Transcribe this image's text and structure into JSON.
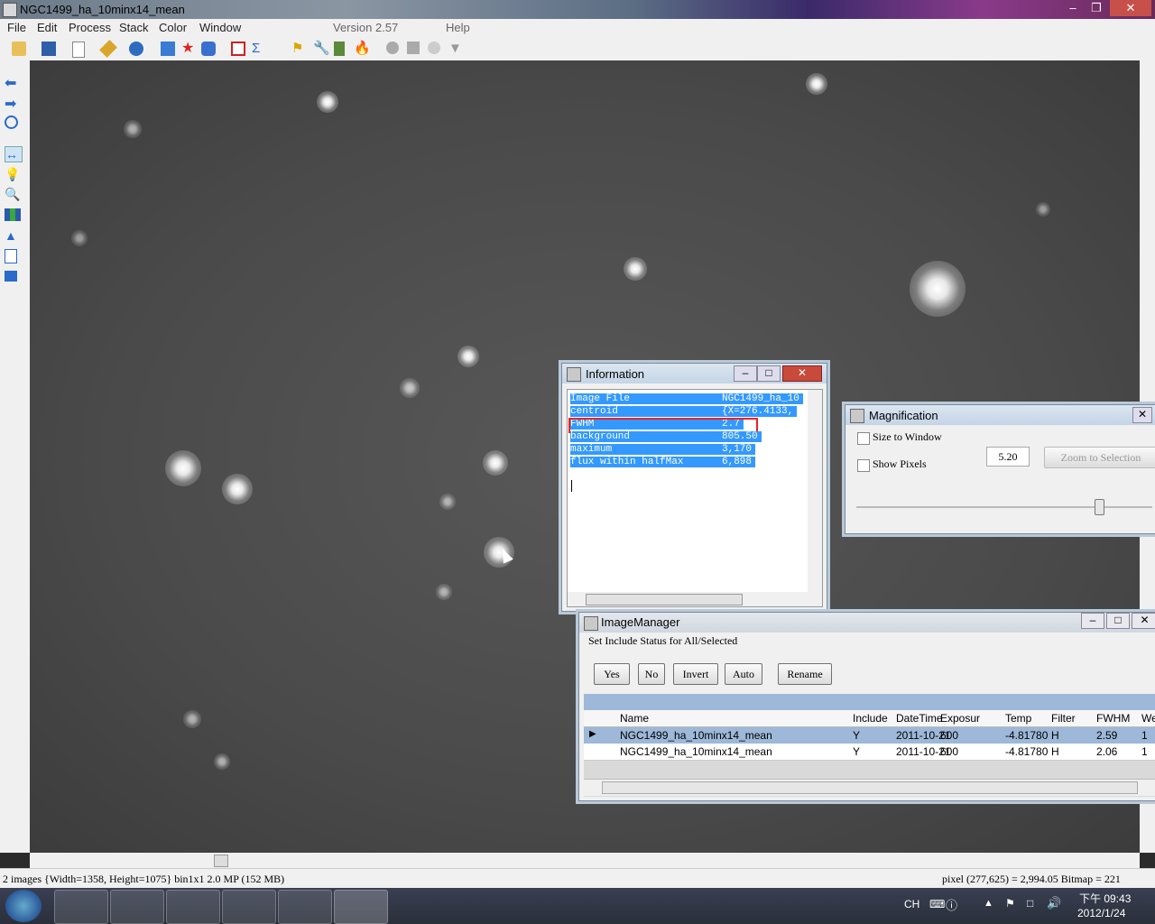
{
  "window": {
    "title": "NGC1499_ha_10minx14_mean"
  },
  "menu": {
    "file": "File",
    "edit": "Edit",
    "process": "Process",
    "stack": "Stack",
    "color": "Color",
    "window": "Window",
    "version": "Version 2.57",
    "help": "Help"
  },
  "info": {
    "title": "Information",
    "rows": [
      {
        "label": "Image File",
        "value": "NGC1499_ha_10"
      },
      {
        "label": "centroid",
        "value": "{X=276.4133,"
      },
      {
        "label": "FWHM",
        "value": "2.7"
      },
      {
        "label": "background",
        "value": "805.50"
      },
      {
        "label": "maximum",
        "value": "3,170"
      },
      {
        "label": "flux within halfMax",
        "value": "6,898"
      }
    ]
  },
  "magnification": {
    "title": "Magnification",
    "size_to_window": "Size to Window",
    "show_pixels": "Show Pixels",
    "value": "5.20",
    "zoom_button": "Zoom to Selection"
  },
  "image_manager": {
    "title": "ImageManager",
    "group_label": "Set Include Status for All/Selected",
    "buttons": {
      "yes": "Yes",
      "no": "No",
      "invert": "Invert",
      "auto": "Auto",
      "rename": "Rename"
    },
    "columns": [
      "Name",
      "Include",
      "DateTime",
      "Exposur",
      "Temp",
      "Filter",
      "FWHM",
      "We"
    ],
    "rows": [
      [
        "NGC1499_ha_10minx14_mean",
        "Y",
        "2011-10-21",
        "600",
        "-4.81780",
        "H",
        "2.59",
        "1"
      ],
      [
        "NGC1499_ha_10minx14_mean",
        "Y",
        "2011-10-21",
        "600",
        "-4.81780",
        "H",
        "2.06",
        "1"
      ]
    ]
  },
  "status": {
    "left": "2 images  {Width=1358, Height=1075} bin1x1  2.0 MP (152 MB)",
    "right": "pixel (277,625) = 2,994.05  Bitmap = 221"
  },
  "taskbar": {
    "lang": "CH",
    "time": "下午 09:43",
    "date": "2012/1/24"
  }
}
